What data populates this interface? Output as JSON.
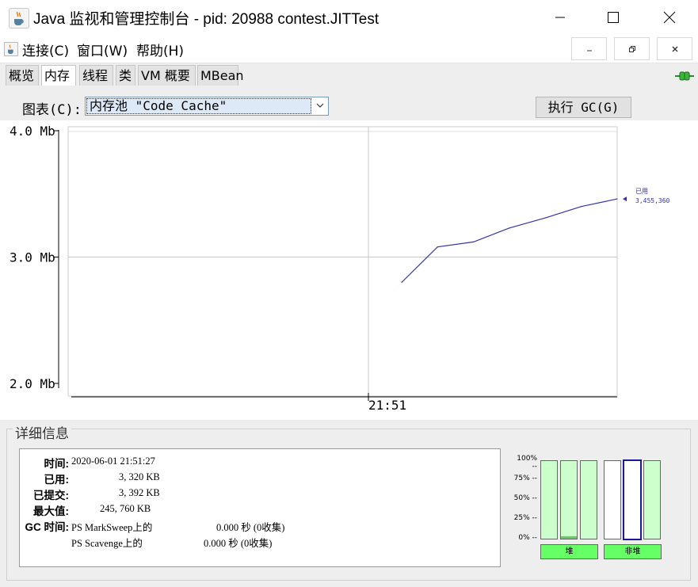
{
  "window": {
    "title": "Java 监视和管理控制台 - pid: 20988 contest.JITTest",
    "app_icon": "java-coffee-icon"
  },
  "menu": {
    "items": [
      "连接(C)",
      "窗口(W)",
      "帮助(H)"
    ]
  },
  "tabs": [
    "概览",
    "内存",
    "线程",
    "类",
    "VM 概要",
    "MBean"
  ],
  "active_tab": "内存",
  "chart_selector": {
    "label": "图表(C):",
    "value": "内存池 \"Code Cache\""
  },
  "gc_button": "执行 GC(G)",
  "chart_data": {
    "type": "line",
    "y_ticks": [
      "4.0 Mb",
      "3.0 Mb",
      "2.0 Mb"
    ],
    "x_ticks": [
      "21:51"
    ],
    "ylim": [
      2.0,
      4.0
    ],
    "series": [
      {
        "name": "已用",
        "color": "#3333aa",
        "x": [
          0,
          1,
          2,
          3,
          4,
          5,
          6
        ],
        "values": [
          2.8,
          3.08,
          3.12,
          3.23,
          3.31,
          3.4,
          3.46
        ]
      }
    ],
    "latest_label": "已用",
    "latest_value": "3,455,360"
  },
  "details": {
    "title": "详细信息",
    "labels": {
      "time": "时间:",
      "used": "已用:",
      "committed": "已提交:",
      "max": "最大值:",
      "gc_time": "GC 时间:"
    },
    "values": {
      "time": "2020-06-01 21:51:27",
      "used": "3, 320 KB",
      "committed": "3, 392 KB",
      "max": "245, 760 KB"
    },
    "gc": [
      {
        "collector": "PS MarkSweep上的",
        "time": "0.000 秒 (0收集)"
      },
      {
        "collector": "PS Scavenge上的",
        "time": "0.000 秒 (0收集)"
      }
    ]
  },
  "pool_chart": {
    "pct_labels": [
      "100% --",
      "75% --",
      "50% --",
      "25% --",
      "0% --"
    ],
    "heap_label": "堆",
    "nonheap_label": "非堆",
    "heap_bars": [
      0.0,
      0.03,
      0.0
    ],
    "nonheap_bars": [
      0.0,
      0.0,
      0.0
    ],
    "fill_color": "#ccffcc",
    "label_color": "#66ff66"
  }
}
